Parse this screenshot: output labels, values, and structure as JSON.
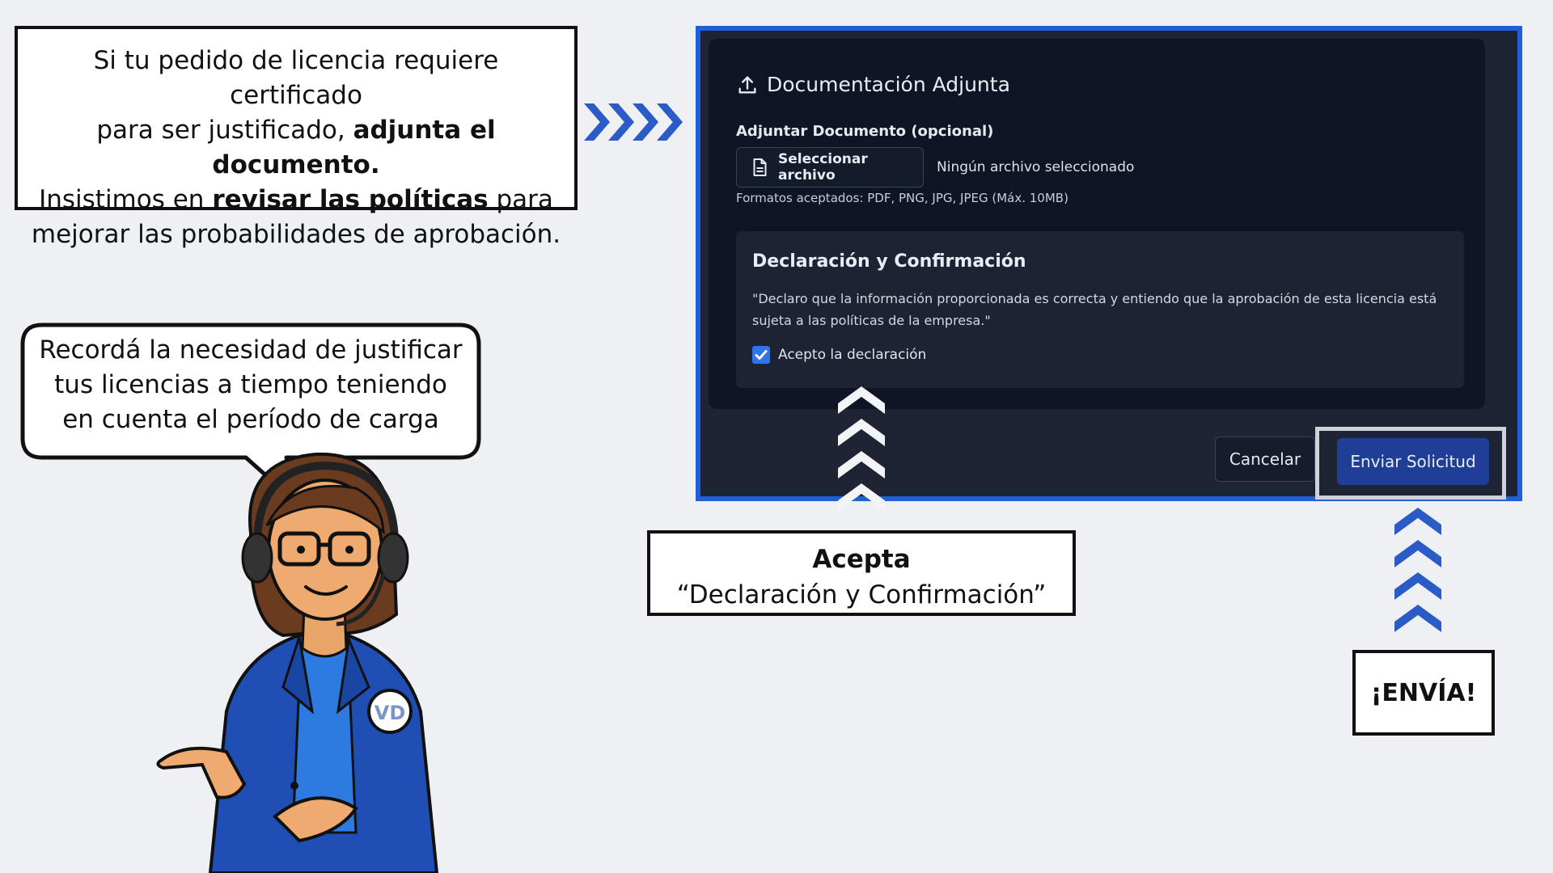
{
  "callouts": {
    "attach": {
      "line1": "Si tu pedido de licencia requiere certificado",
      "line2_prefix": "para ser justificado,",
      "line2_bold": "adjunta el documento.",
      "line3_prefix": "Insistimos en",
      "line3_bold": "revisar las políticas",
      "line3_suffix": "para",
      "line4": "mejorar las probabilidades de aprobación."
    },
    "acepta": {
      "bold": "Acepta",
      "quote": "“Declaración y Confirmación”"
    },
    "envia": "¡ENVÍA!",
    "speech": {
      "line1": "Recordá la necesidad de justificar",
      "line2": "tus licencias a tiempo teniendo",
      "line3": "en cuenta el período de carga"
    }
  },
  "form": {
    "section_title": "Documentación Adjunta",
    "attach_label": "Adjuntar Documento (opcional)",
    "file_button_label": "Seleccionar archivo",
    "no_file_text": "Ningún archivo seleccionado",
    "formats_text": "Formatos aceptados: PDF, PNG, JPG, JPEG (Máx. 10MB)",
    "declaration": {
      "title": "Declaración y Confirmación",
      "text": "\"Declaro que la información proporcionada es correcta y entiendo que la aprobación de esta licencia está sujeta a las políticas de la empresa.\"",
      "checkbox_label": "Acepto la declaración",
      "checked": true
    },
    "cancel_label": "Cancelar",
    "submit_label": "Enviar Solicitud"
  },
  "character": {
    "badge": "VD"
  },
  "colors": {
    "accent_blue": "#2a5bc7",
    "frame_blue": "#1f5fd8",
    "panel_bg": "#0f1524",
    "submit_bg": "#1f3f96",
    "blazer": "#1f4fb5",
    "page_bg": "#eef0f3"
  },
  "icons": [
    "upload-icon",
    "file-icon",
    "checkmark-icon",
    "chevron-right-icon",
    "chevron-up-icon"
  ]
}
